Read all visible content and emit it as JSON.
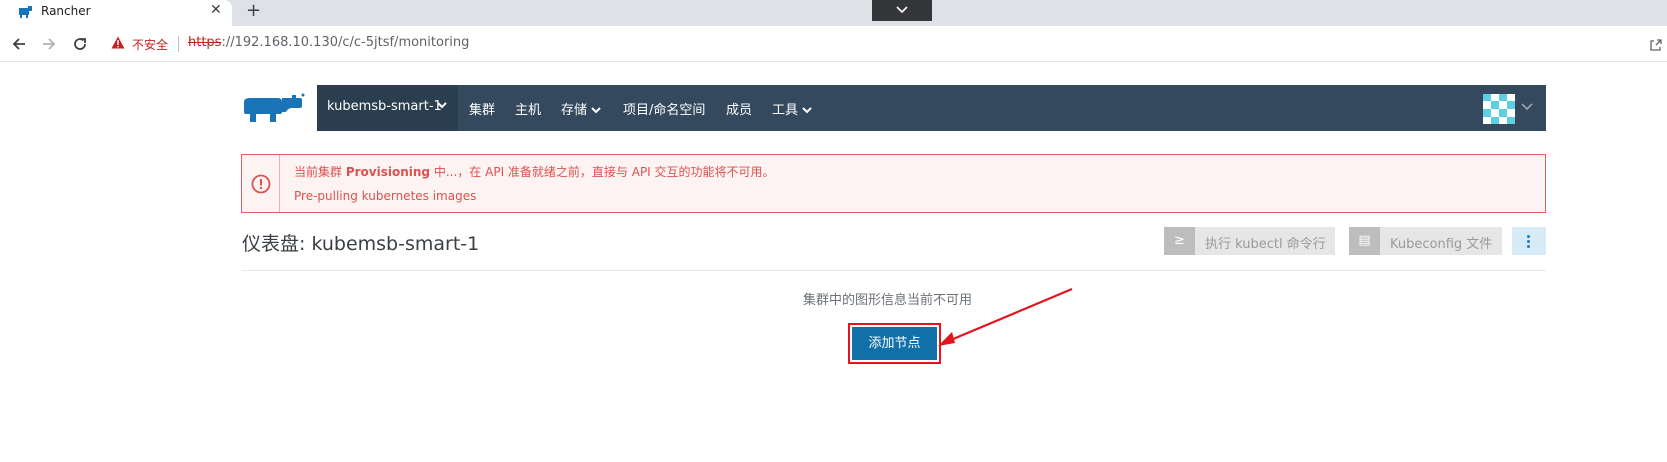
{
  "browser": {
    "tab_title": "Rancher",
    "tab_close": "✕",
    "new_tab": "+",
    "insecure_label": "不安全",
    "url_scheme": "https",
    "url_rest": "://192.168.10.130/c/c-5jtsf/monitoring"
  },
  "header": {
    "cluster_name": "kubemsb-smart-1",
    "nav": [
      {
        "label": "集群"
      },
      {
        "label": "主机"
      },
      {
        "label": "存储"
      },
      {
        "label": "项目/命名空间"
      },
      {
        "label": "成员"
      },
      {
        "label": "工具"
      }
    ]
  },
  "alert": {
    "line1_prefix": "当前集群",
    "line1_bold": "Provisioning",
    "line1_suffix": "中...，在 API 准备就绪之前，直接与 API 交互的功能将不可用。",
    "line2": "Pre-pulling kubernetes images"
  },
  "page": {
    "title": "仪表盘: kubemsb-smart-1",
    "kubectl_icon": "≥",
    "kubectl_button": "执行 kubectl 命令行",
    "kubeconfig_icon": "▤",
    "kubeconfig_button": "Kubeconfig 文件",
    "empty_message": "集群中的图形信息当前不可用",
    "add_node_button": "添加节点"
  },
  "colors": {
    "header_bg": "#34495e",
    "cluster_bg": "#2b3e50",
    "alert_text": "#d9534f",
    "primary_button": "#1270a8",
    "highlight_border": "#e4141b"
  }
}
